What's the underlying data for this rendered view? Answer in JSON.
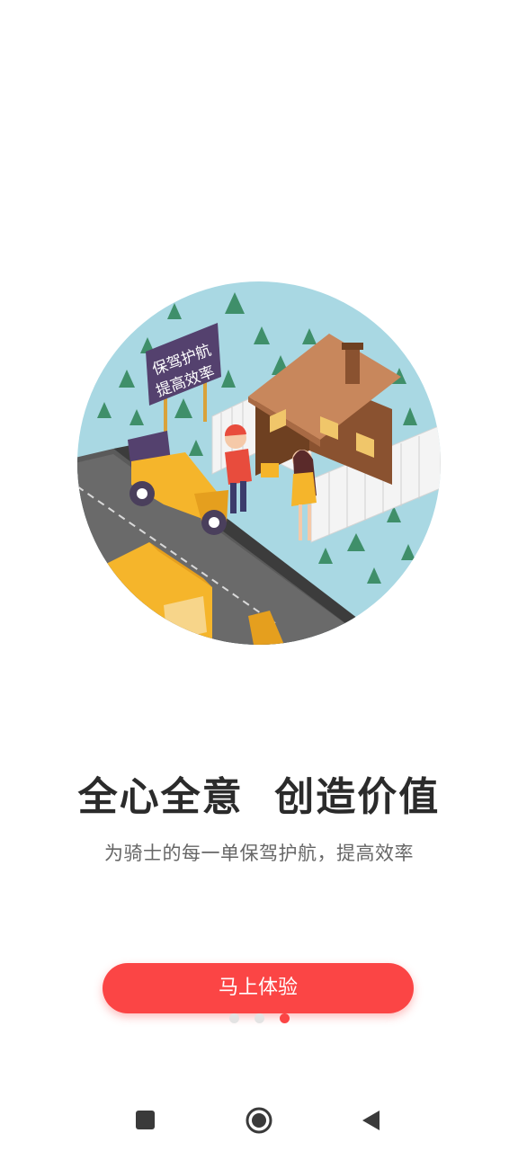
{
  "onboarding": {
    "illustration_sign": [
      "保驾护航",
      "提高效率"
    ],
    "headline": "全心全意  创造价值",
    "subline": "为骑士的每一单保驾护航，提高效率",
    "cta_label": "马上体验",
    "page_indicator": {
      "total": 3,
      "active": 3
    }
  },
  "colors": {
    "accent": "#fb4545",
    "sky": "#a9d8e3",
    "road": "#555555",
    "tree": "#3f8f6a",
    "scooter": "#f5b52b",
    "house_roof": "#c8875c",
    "house_wall": "#8a5230",
    "sign": "#54416e"
  },
  "navbar": {
    "icons": [
      "recent-apps-icon",
      "home-icon",
      "back-icon"
    ]
  }
}
